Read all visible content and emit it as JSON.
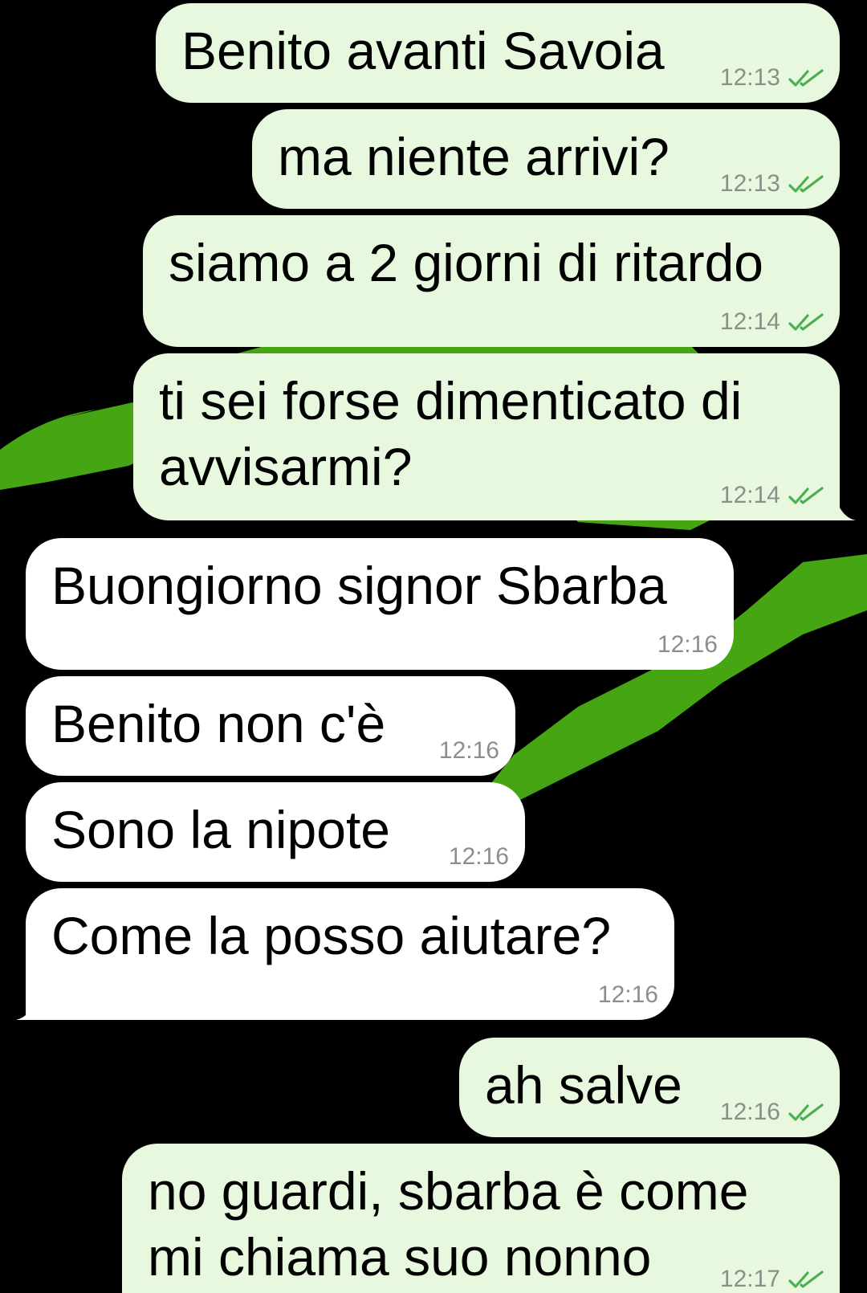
{
  "theme": {
    "background": "#000000",
    "wallpaper_accent": "#46a512",
    "outgoing_bubble": "#e7f8de",
    "incoming_bubble": "#ffffff",
    "read_ticks": "#4caf50",
    "time_text": "#8a8f8a"
  },
  "messages": [
    {
      "direction": "outgoing",
      "lines": [
        "Benito avanti Savoia"
      ],
      "time": "12:13",
      "status_icon": "double-check-icon"
    },
    {
      "direction": "outgoing",
      "lines": [
        "ma niente arrivi?"
      ],
      "time": "12:13",
      "status_icon": "double-check-icon"
    },
    {
      "direction": "outgoing",
      "lines": [
        "siamo a 2 giorni di ritardo"
      ],
      "time": "12:14",
      "status_icon": "double-check-icon"
    },
    {
      "direction": "outgoing",
      "lines": [
        "ti sei forse dimenticato di",
        "avvisarmi?"
      ],
      "time": "12:14",
      "status_icon": "double-check-icon"
    },
    {
      "direction": "incoming",
      "lines": [
        "Buongiorno signor Sbarba"
      ],
      "time": "12:16"
    },
    {
      "direction": "incoming",
      "lines": [
        "Benito non c'è"
      ],
      "time": "12:16"
    },
    {
      "direction": "incoming",
      "lines": [
        "Sono la nipote"
      ],
      "time": "12:16"
    },
    {
      "direction": "incoming",
      "lines": [
        "Come la posso aiutare?"
      ],
      "time": "12:16"
    },
    {
      "direction": "outgoing",
      "lines": [
        "ah salve"
      ],
      "time": "12:16",
      "status_icon": "double-check-icon"
    },
    {
      "direction": "outgoing",
      "lines": [
        "no guardi, sbarba è come",
        "mi chiama suo nonno"
      ],
      "time": "12:17",
      "status_icon": "double-check-icon"
    }
  ]
}
